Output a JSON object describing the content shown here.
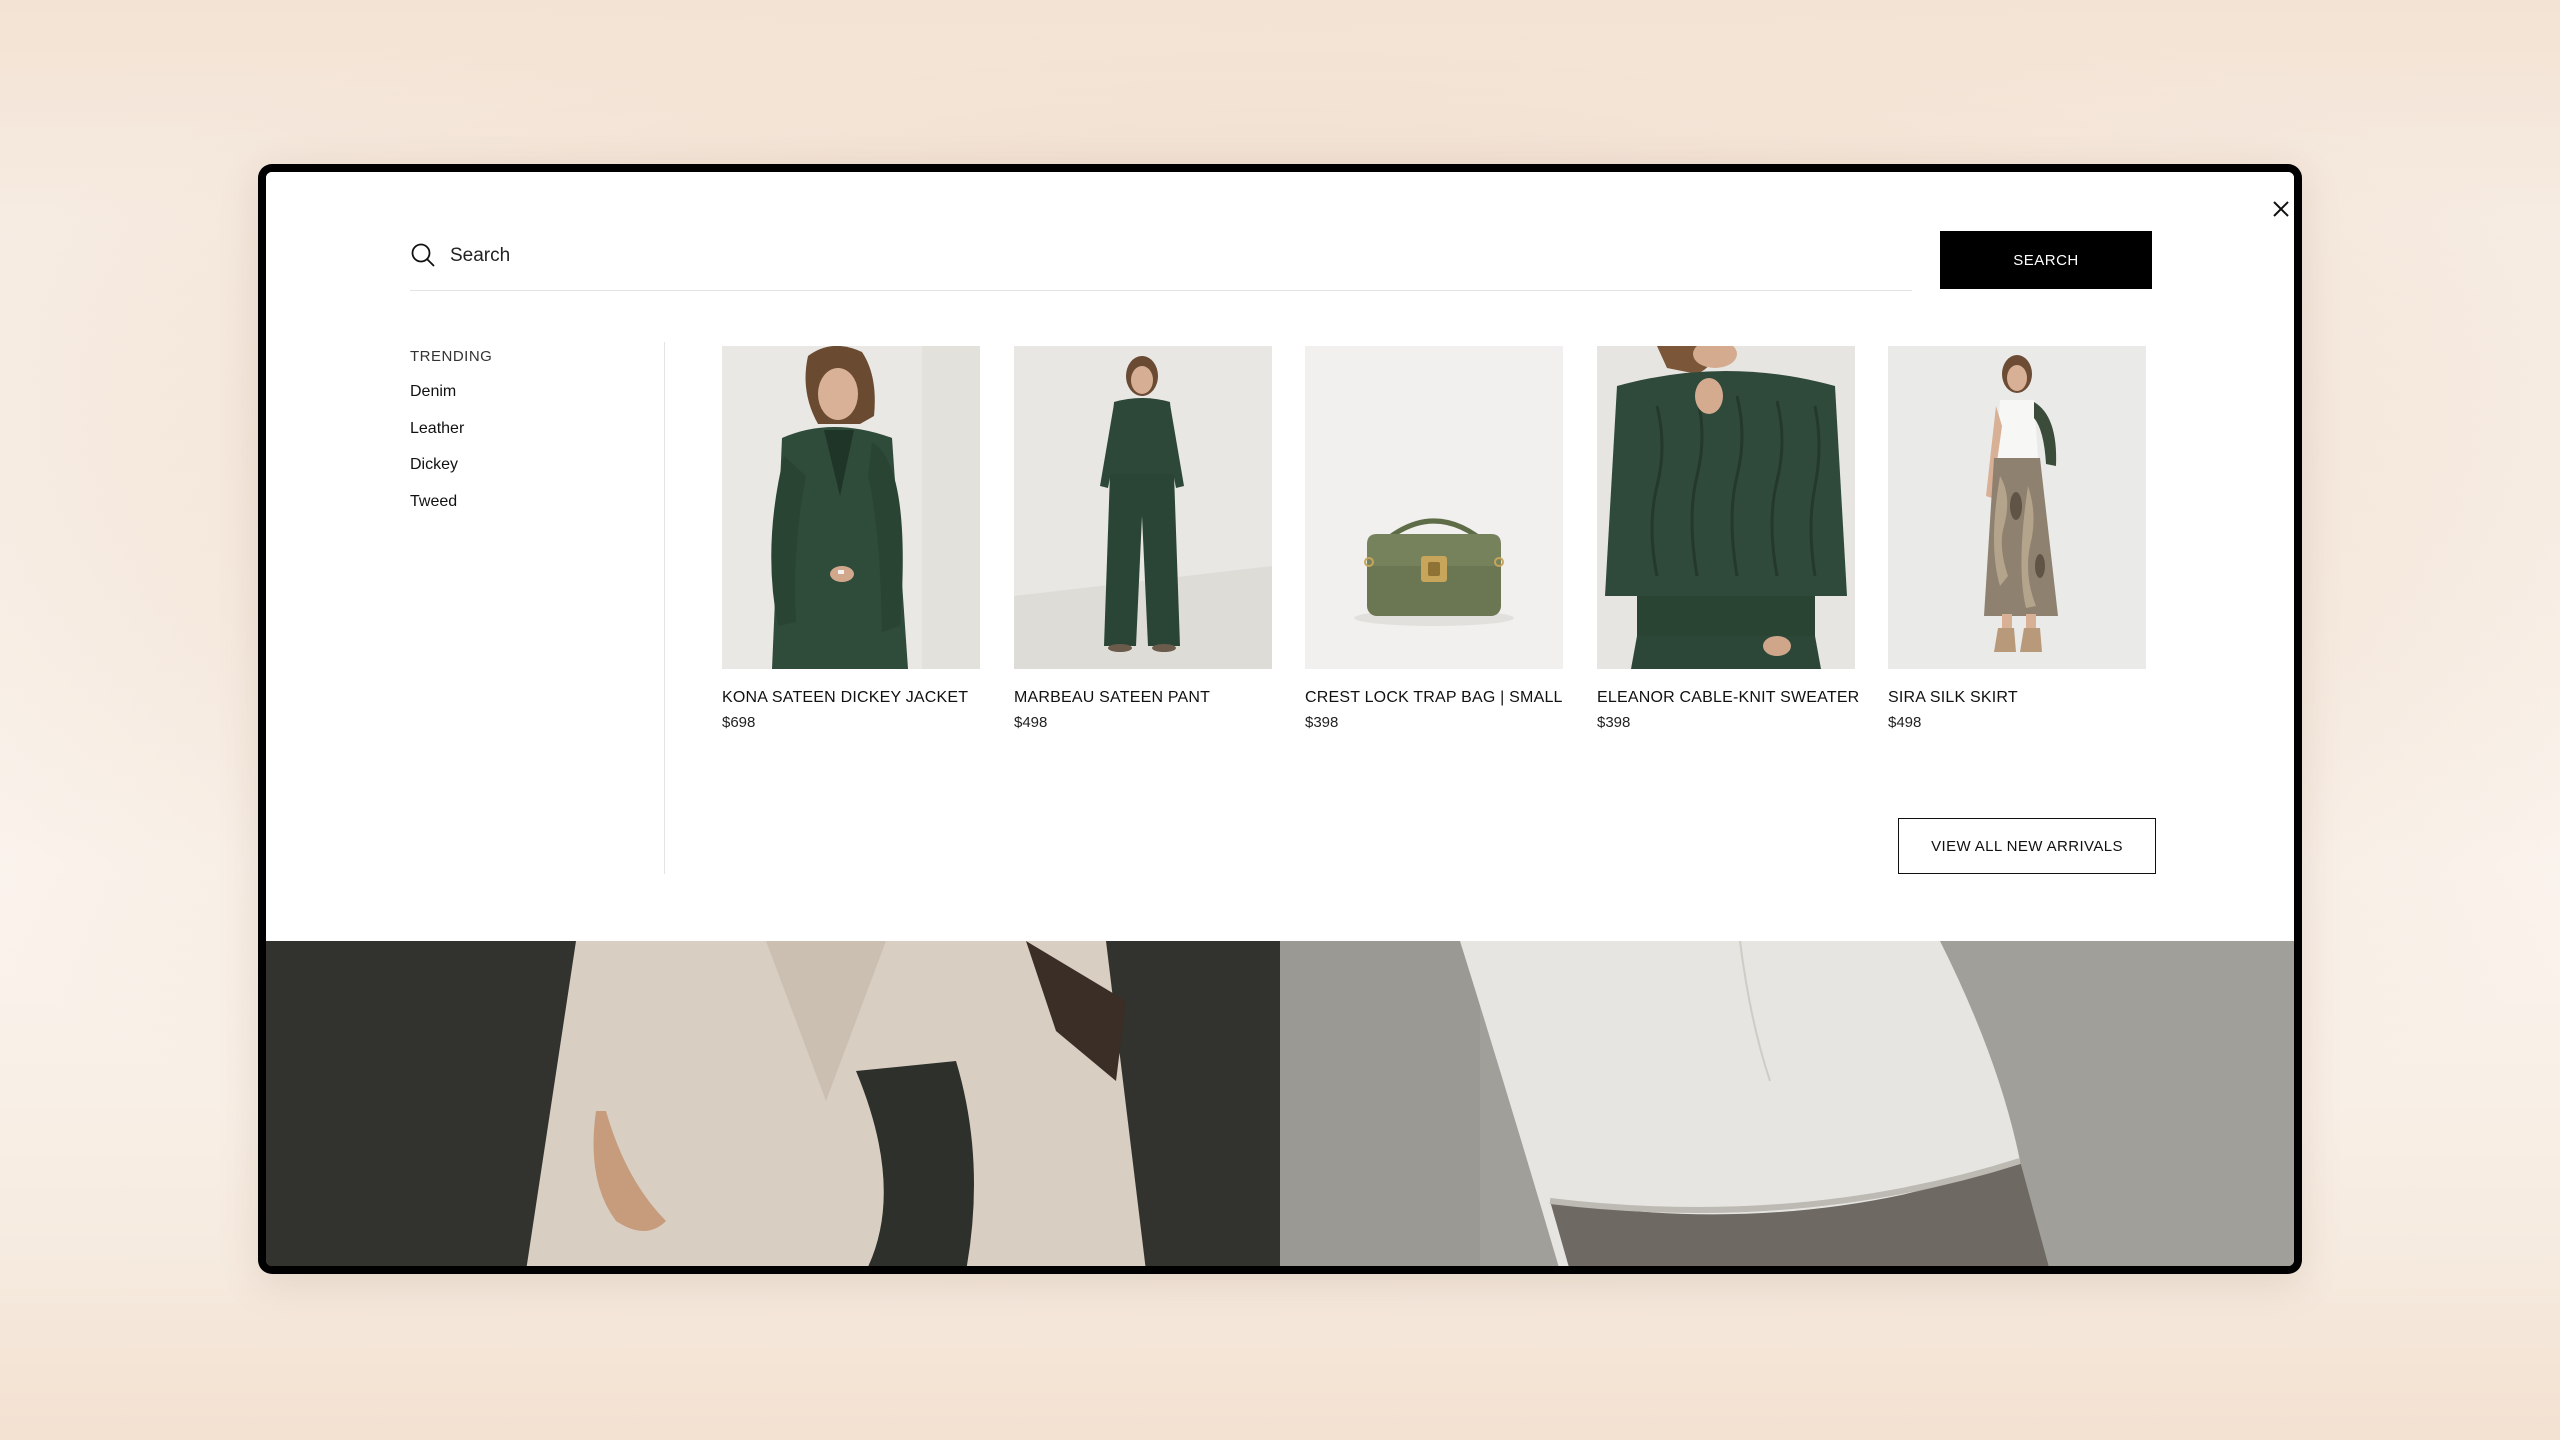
{
  "search": {
    "placeholder": "Search",
    "button_label": "SEARCH"
  },
  "trending": {
    "heading": "TRENDING",
    "items": [
      "Denim",
      "Leather",
      "Dickey",
      "Tweed"
    ]
  },
  "products": [
    {
      "name": "KONA SATEEN DICKEY JACKET",
      "price": "$698"
    },
    {
      "name": "MARBEAU SATEEN PANT",
      "price": "$498"
    },
    {
      "name": "CREST LOCK TRAP BAG | SMALL",
      "price": "$398"
    },
    {
      "name": "ELEANOR CABLE-KNIT SWEATER",
      "price": "$398"
    },
    {
      "name": "SIRA SILK SKIRT",
      "price": "$498"
    }
  ],
  "view_all_label": "VIEW ALL NEW ARRIVALS",
  "icons": {
    "close": "close-icon",
    "search": "search-icon"
  },
  "colors": {
    "accent": "#000000",
    "product_green": "#2f4a3a"
  }
}
